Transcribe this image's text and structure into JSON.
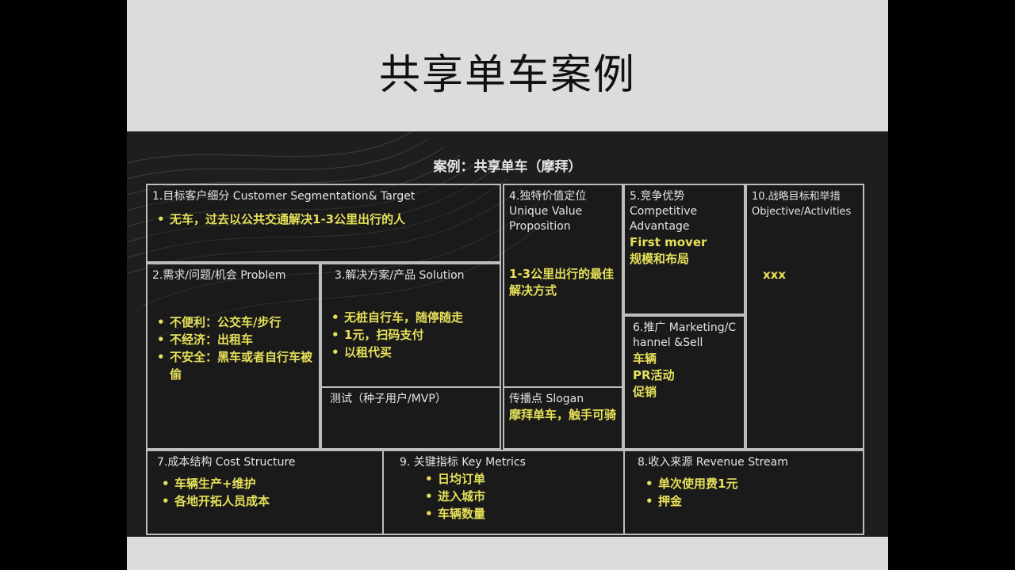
{
  "slide_title": "共享单车案例",
  "canvas_title": "案例：共享单车（摩拜）",
  "boxes": {
    "b1": {
      "heading": "1.目标客户细分 Customer Segmentation& Target",
      "bullets": [
        "无车，过去以公共交通解决1-3公里出行的人"
      ]
    },
    "b2": {
      "heading": "2.需求/问题/机会 Problem",
      "bullets": [
        "不便利：公交车/步行",
        "不经济：出租车",
        "不安全：黑车或者自行车被偷"
      ]
    },
    "b3": {
      "heading": "3.解决方案/产品 Solution",
      "bullets": [
        "无桩自行车，随停随走",
        "1元，扫码支付",
        "以租代买"
      ]
    },
    "btest": {
      "heading": "测试（种子用户/MVP）"
    },
    "b4": {
      "heading": "4.独特价值定位 Unique Value Proposition",
      "value": "1-3公里出行的最佳解决方式"
    },
    "bslogan": {
      "heading": "传播点 Slogan",
      "value": "摩拜单车，触手可骑"
    },
    "b5": {
      "heading": "5.竞争优势 Competitive Advantage",
      "lines": [
        "First mover",
        "规模和布局"
      ]
    },
    "b6": {
      "heading": "6.推广 Marketing/Channel &Sell",
      "lines": [
        "车辆",
        "PR活动",
        "促销"
      ]
    },
    "b10": {
      "heading": "10.战略目标和举措 Objective/Activities",
      "value": "xxx"
    },
    "b7": {
      "heading": "7.成本结构 Cost Structure",
      "bullets": [
        "车辆生产+维护",
        "各地开拓人员成本"
      ]
    },
    "b9": {
      "heading": "9. 关键指标 Key Metrics",
      "bullets": [
        "日均订单",
        "进入城市",
        "车辆数量"
      ]
    },
    "b8": {
      "heading": "8.收入来源 Revenue Stream",
      "bullets": [
        "单次使用费1元",
        "押金"
      ]
    }
  }
}
